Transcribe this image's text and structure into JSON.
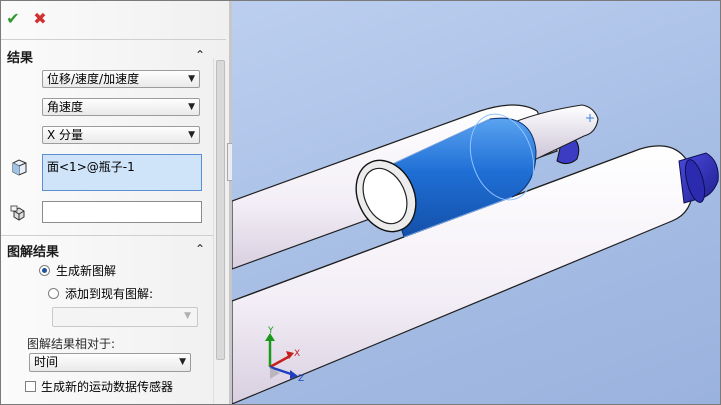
{
  "toolbar": {
    "ok_symbol": "✔",
    "cancel_symbol": "✖"
  },
  "results": {
    "title": "结果",
    "category": "位移/速度/加速度",
    "quantity": "角速度",
    "component": "X 分量",
    "selection": "面<1>@瓶子-1",
    "reference": ""
  },
  "plot": {
    "title": "图解结果",
    "option_new": "生成新图解",
    "option_existing": "添加到现有图解:",
    "existing_value": "",
    "relative_label": "图解结果相对于:",
    "relative_value": "时间",
    "sensor_label": "生成新的运动数据传感器",
    "selected_option": "new",
    "sensor_checked": false
  },
  "triad": {
    "x": "X",
    "y": "Y",
    "z": "Z"
  },
  "icons": {
    "ok": "check-icon",
    "cancel": "close-icon",
    "face": "face-selection-icon",
    "ref": "reference-component-icon",
    "collapse": "chevron-up-icon",
    "dropdown": "chevron-down-icon"
  },
  "colors": {
    "background": "#a9c0e6",
    "selected_face": "#1f6fd6",
    "cylinder": "#f8f4fa",
    "end_cap": "#2f2fb6",
    "selection_box": "#cfe4f8"
  }
}
